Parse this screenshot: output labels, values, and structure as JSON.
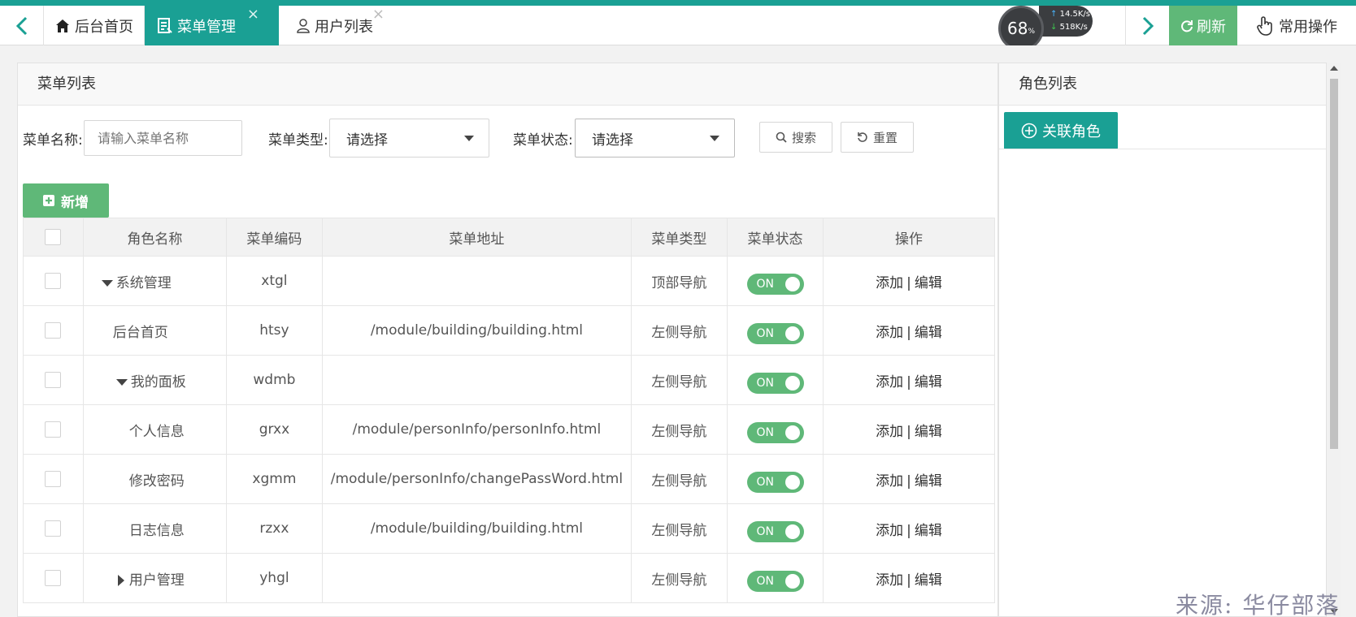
{
  "tabs": {
    "home": "后台首页",
    "menu": "菜单管理",
    "user": "用户列表",
    "close": "×"
  },
  "monitor": {
    "percent": "68",
    "percent_unit": "%",
    "up_speed": "14.5K/s",
    "down_speed": "518K/s"
  },
  "toolbar": {
    "refresh": "刷新",
    "common": "常用操作"
  },
  "left_panel": {
    "title": "菜单列表",
    "search": {
      "name_label": "菜单名称:",
      "name_placeholder": "请输入菜单名称",
      "type_label": "菜单类型:",
      "type_value": "请选择",
      "status_label": "菜单状态:",
      "status_value": "请选择",
      "search_btn": "搜索",
      "reset_btn": "重置"
    },
    "add_btn": "新增",
    "table": {
      "headers": [
        "角色名称",
        "菜单编码",
        "菜单地址",
        "菜单类型",
        "菜单状态",
        "操作"
      ],
      "rows": [
        {
          "name": "系统管理",
          "code": "xtgl",
          "url": "",
          "type": "顶部导航",
          "status": "ON",
          "add": "添加",
          "sep": "|",
          "edit": "编辑"
        },
        {
          "name": "后台首页",
          "code": "htsy",
          "url": "/module/building/building.html",
          "type": "左侧导航",
          "status": "ON",
          "add": "添加",
          "sep": "|",
          "edit": "编辑"
        },
        {
          "name": "我的面板",
          "code": "wdmb",
          "url": "",
          "type": "左侧导航",
          "status": "ON",
          "add": "添加",
          "sep": "|",
          "edit": "编辑"
        },
        {
          "name": "个人信息",
          "code": "grxx",
          "url": "/module/personInfo/personInfo.html",
          "type": "左侧导航",
          "status": "ON",
          "add": "添加",
          "sep": "|",
          "edit": "编辑"
        },
        {
          "name": "修改密码",
          "code": "xgmm",
          "url": "/module/personInfo/changePassWord.html",
          "type": "左侧导航",
          "status": "ON",
          "add": "添加",
          "sep": "|",
          "edit": "编辑"
        },
        {
          "name": "日志信息",
          "code": "rzxx",
          "url": "/module/building/building.html",
          "type": "左侧导航",
          "status": "ON",
          "add": "添加",
          "sep": "|",
          "edit": "编辑"
        },
        {
          "name": "用户管理",
          "code": "yhgl",
          "url": "",
          "type": "左侧导航",
          "status": "ON",
          "add": "添加",
          "sep": "|",
          "edit": "编辑"
        }
      ]
    }
  },
  "right_panel": {
    "title": "角色列表",
    "relate_btn": "关联角色"
  },
  "watermark": "来源: 华仔部落",
  "colors": {
    "brand": "#1aa094",
    "green": "#5fb878"
  }
}
